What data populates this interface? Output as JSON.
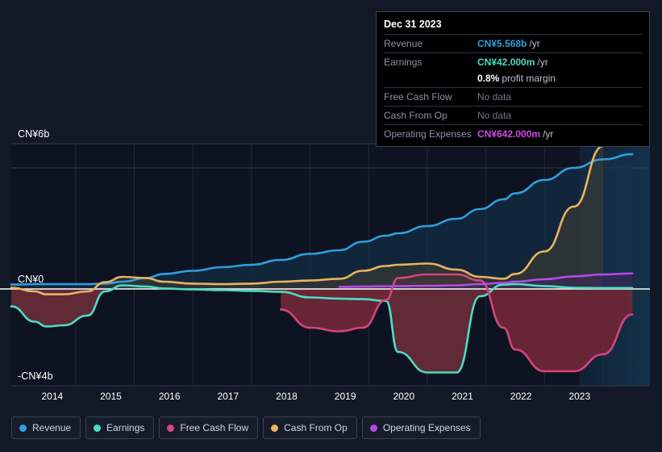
{
  "chart_data": {
    "type": "line",
    "title": "",
    "xlabel": "",
    "ylabel": "",
    "currency": "CN¥",
    "ylim": [
      -4,
      6
    ],
    "ytick_labels": [
      "CN¥6b",
      "CN¥0",
      "-CN¥4b"
    ],
    "ytick_values": [
      6,
      0,
      -4
    ],
    "grid": true,
    "legend_position": "bottom-left",
    "xlim": [
      2013.4,
      2024.3
    ],
    "categories": [
      "2014",
      "2015",
      "2016",
      "2017",
      "2018",
      "2019",
      "2020",
      "2021",
      "2022",
      "2023"
    ],
    "x": [
      2013.4,
      2013.8,
      2014.0,
      2014.3,
      2014.7,
      2015.0,
      2015.3,
      2015.7,
      2016.0,
      2016.5,
      2017.0,
      2017.5,
      2018.0,
      2018.5,
      2019.0,
      2019.4,
      2019.8,
      2020.0,
      2020.5,
      2021.0,
      2021.4,
      2021.8,
      2022.0,
      2022.5,
      2023.0,
      2023.5,
      2024.0
    ],
    "series": [
      {
        "name": "Revenue",
        "color": "#2f9fe0",
        "fill": "#17324c",
        "values": [
          0.18,
          0.2,
          0.2,
          0.2,
          0.2,
          0.22,
          0.3,
          0.45,
          0.62,
          0.75,
          0.9,
          1.0,
          1.2,
          1.45,
          1.6,
          1.95,
          2.2,
          2.3,
          2.6,
          2.9,
          3.3,
          3.7,
          3.95,
          4.5,
          5.0,
          5.35,
          5.568
        ],
        "end_value": 5.568,
        "end_label": "CN¥5.568b"
      },
      {
        "name": "Earnings",
        "color": "#4bddc4",
        "fill": "#2a4a4f",
        "values": [
          -0.72,
          -1.35,
          -1.55,
          -1.5,
          -1.1,
          -0.1,
          0.15,
          0.1,
          0.02,
          -0.02,
          -0.05,
          -0.08,
          -0.12,
          -0.35,
          -0.4,
          -0.42,
          -0.5,
          -2.6,
          -3.45,
          -3.45,
          -0.3,
          0.18,
          0.2,
          0.12,
          0.05,
          0.04,
          0.042
        ],
        "end_value": 0.042,
        "end_label": "CN¥42.000m"
      },
      {
        "name": "Free Cash Flow",
        "color": "#d6447f",
        "fill": "#5c2539",
        "values": [
          null,
          null,
          null,
          null,
          null,
          null,
          null,
          null,
          null,
          null,
          null,
          null,
          -0.85,
          -1.6,
          -1.75,
          -1.6,
          -0.45,
          0.45,
          0.6,
          0.6,
          0.35,
          -1.6,
          -2.5,
          -3.4,
          -3.4,
          -2.7,
          -1.05
        ],
        "end_value": -1.05,
        "end_label": null
      },
      {
        "name": "Cash From Op",
        "color": "#e9b361",
        "fill": "#3d3b33",
        "values": [
          0.05,
          -0.1,
          -0.22,
          -0.22,
          -0.1,
          0.28,
          0.5,
          0.45,
          0.3,
          0.22,
          0.2,
          0.22,
          0.3,
          0.35,
          0.42,
          0.75,
          0.95,
          1.0,
          1.05,
          0.8,
          0.5,
          0.42,
          0.62,
          1.55,
          3.4,
          5.9,
          null
        ],
        "end_value": 5.9,
        "end_label": null
      },
      {
        "name": "Operating Expenses",
        "color": "#b44ae8",
        "fill": "#3b2a58",
        "values": [
          null,
          null,
          null,
          null,
          null,
          null,
          null,
          null,
          null,
          null,
          null,
          null,
          null,
          null,
          0.09,
          0.1,
          0.11,
          0.12,
          0.13,
          0.15,
          0.2,
          0.25,
          0.3,
          0.4,
          0.52,
          0.6,
          0.642
        ],
        "end_value": 0.642,
        "end_label": "CN¥642.000m"
      }
    ],
    "forecast_start": "2023.1"
  },
  "tooltip": {
    "date": "Dec 31 2023",
    "rows": [
      {
        "key": "Revenue",
        "value": "CN¥5.568b",
        "unit": "/yr",
        "color": "#2f9fe0",
        "nodata": false
      },
      {
        "key": "Earnings",
        "value": "CN¥42.000m",
        "unit": "/yr",
        "color": "#4bddc4",
        "nodata": false
      },
      {
        "key": "Free Cash Flow",
        "value": "No data",
        "unit": "",
        "color": "#6f7686",
        "nodata": true
      },
      {
        "key": "Cash From Op",
        "value": "No data",
        "unit": "",
        "color": "#6f7686",
        "nodata": true
      },
      {
        "key": "Operating Expenses",
        "value": "CN¥642.000m",
        "unit": "/yr",
        "color": "#d14ae8",
        "nodata": false
      }
    ],
    "margin_value": "0.8%",
    "margin_label": "profit margin"
  },
  "legend": {
    "items": [
      {
        "label": "Revenue",
        "color": "#2f9fe0"
      },
      {
        "label": "Earnings",
        "color": "#4bddc4"
      },
      {
        "label": "Free Cash Flow",
        "color": "#d6447f"
      },
      {
        "label": "Cash From Op",
        "color": "#e9b361"
      },
      {
        "label": "Operating Expenses",
        "color": "#b44ae8"
      }
    ]
  },
  "axes": {
    "y_top": "CN¥6b",
    "y_zero": "CN¥0",
    "y_bottom": "-CN¥4b"
  }
}
